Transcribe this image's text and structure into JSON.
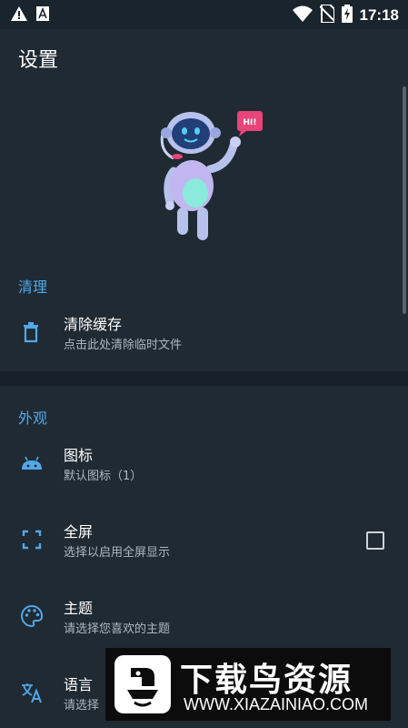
{
  "status_bar": {
    "time": "17:18",
    "icons": [
      "warning-icon",
      "font-icon",
      "wifi-icon",
      "no-sim-icon",
      "battery-charging-icon"
    ]
  },
  "header": {
    "title": "设置"
  },
  "hero": {
    "bubble_text": "HI!"
  },
  "sections": {
    "clean": {
      "header": "清理",
      "items": [
        {
          "title": "清除缓存",
          "summary": "点击此处清除临时文件",
          "icon": "trash-icon"
        }
      ]
    },
    "appearance": {
      "header": "外观",
      "items": [
        {
          "title": "图标",
          "summary": "默认图标（1）",
          "icon": "android-icon"
        },
        {
          "title": "全屏",
          "summary": "选择以启用全屏显示",
          "icon": "fullscreen-icon",
          "checked": false
        },
        {
          "title": "主题",
          "summary": "请选择您喜欢的主题",
          "icon": "palette-icon"
        },
        {
          "title": "语言",
          "summary": "请选择",
          "icon": "translate-icon"
        }
      ]
    }
  },
  "watermark": {
    "title": "下载鸟资源",
    "url": "WWW.XIAZAINIAO.COM"
  },
  "colors": {
    "background": "#1f2a33",
    "accent": "#52a8e8",
    "divider": "#17202a"
  }
}
